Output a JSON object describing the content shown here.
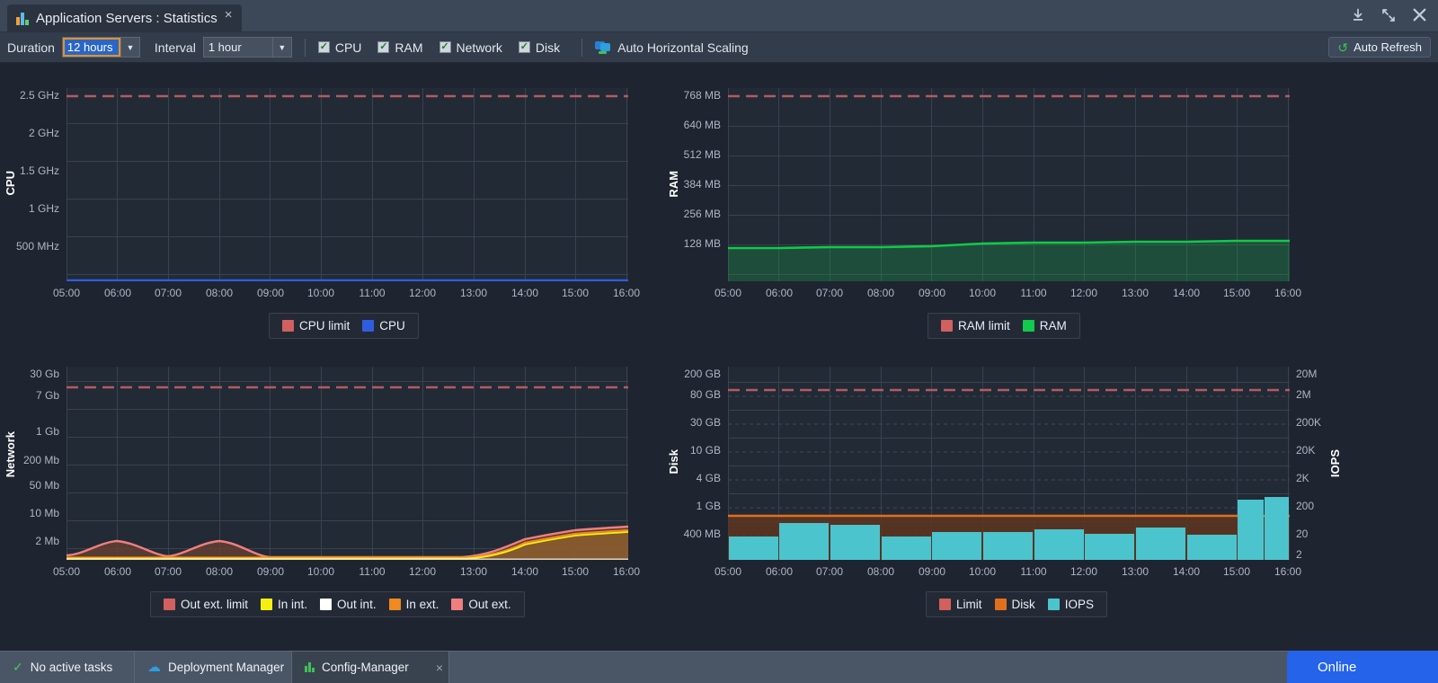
{
  "window": {
    "tab_title": "Application Servers : Statistics",
    "tab_close": "×",
    "download_icon": "download-icon",
    "restore_icon": "restore-icon",
    "close_icon": "✕"
  },
  "toolbar": {
    "duration_label": "Duration",
    "duration_value": "12 hours",
    "interval_label": "Interval",
    "interval_value": "1 hour",
    "arrow": "▼",
    "checkboxes": [
      {
        "label": "CPU",
        "checked": true,
        "mark": "✓"
      },
      {
        "label": "RAM",
        "checked": true,
        "mark": "✓"
      },
      {
        "label": "Network",
        "checked": true,
        "mark": "✓"
      },
      {
        "label": "Disk",
        "checked": true,
        "mark": "✓"
      }
    ],
    "auto_scaling_label": "Auto Horizontal Scaling",
    "auto_refresh_label": "Auto Refresh",
    "auto_refresh_icon": "↺"
  },
  "chart_data": [
    {
      "id": "cpu",
      "type": "area",
      "title": "",
      "ylabel": "CPU",
      "xlabel": "",
      "grid": true,
      "x": [
        "05:00",
        "06:00",
        "07:00",
        "08:00",
        "09:00",
        "10:00",
        "11:00",
        "12:00",
        "13:00",
        "14:00",
        "15:00",
        "16:00"
      ],
      "yticks": [
        "500 MHz",
        "1 GHz",
        "1.5 GHz",
        "2 GHz",
        "2.5 GHz"
      ],
      "ylim": [
        0,
        2.75
      ],
      "series": [
        {
          "name": "CPU limit",
          "color": "#d1605e",
          "style": "dashed",
          "value": 2.5,
          "values": [
            2.5,
            2.5,
            2.5,
            2.5,
            2.5,
            2.5,
            2.5,
            2.5,
            2.5,
            2.5,
            2.5,
            2.5
          ]
        },
        {
          "name": "CPU",
          "color": "#2f5de0",
          "style": "area",
          "values": [
            0.01,
            0.01,
            0.01,
            0.01,
            0.01,
            0.01,
            0.01,
            0.01,
            0.01,
            0.01,
            0.01,
            0.01
          ]
        }
      ],
      "legend": [
        {
          "label": "CPU limit",
          "color": "#d1605e"
        },
        {
          "label": "CPU",
          "color": "#2f5de0"
        }
      ]
    },
    {
      "id": "ram",
      "type": "area",
      "title": "",
      "ylabel": "RAM",
      "xlabel": "",
      "grid": true,
      "x": [
        "05:00",
        "06:00",
        "07:00",
        "08:00",
        "09:00",
        "10:00",
        "11:00",
        "12:00",
        "13:00",
        "14:00",
        "15:00",
        "16:00"
      ],
      "yticks": [
        "128 MB",
        "256 MB",
        "384 MB",
        "512 MB",
        "640 MB",
        "768 MB"
      ],
      "ylim": [
        0,
        845
      ],
      "series": [
        {
          "name": "RAM limit",
          "color": "#d1605e",
          "style": "dashed",
          "value": 768,
          "values": [
            768,
            768,
            768,
            768,
            768,
            768,
            768,
            768,
            768,
            768,
            768,
            768
          ]
        },
        {
          "name": "RAM",
          "color": "#11c94a",
          "style": "area",
          "values": [
            128,
            128,
            129,
            129,
            130,
            134,
            135,
            135,
            136,
            137,
            138,
            139
          ]
        }
      ],
      "legend": [
        {
          "label": "RAM limit",
          "color": "#d1605e"
        },
        {
          "label": "RAM",
          "color": "#11c94a"
        }
      ]
    },
    {
      "id": "network",
      "type": "area",
      "title": "",
      "ylabel": "Network",
      "xlabel": "",
      "grid": true,
      "scale": "log",
      "x": [
        "05:00",
        "06:00",
        "07:00",
        "08:00",
        "09:00",
        "10:00",
        "11:00",
        "12:00",
        "13:00",
        "14:00",
        "15:00",
        "16:00"
      ],
      "yticks": [
        "2 Mb",
        "10 Mb",
        "50 Mb",
        "200 Mb",
        "1 Gb",
        "7 Gb",
        "30 Gb"
      ],
      "series": [
        {
          "name": "Out ext. limit",
          "color": "#d1605e",
          "style": "dashed",
          "value": "30 Gb"
        },
        {
          "name": "In int.",
          "color": "#f5f012",
          "style": "area",
          "values": [
            0,
            0,
            0,
            0,
            0,
            0,
            0,
            0,
            0,
            0.1,
            1.2,
            1.5
          ]
        },
        {
          "name": "Out int.",
          "color": "#ffffff",
          "style": "area",
          "values": [
            0,
            0,
            0,
            0,
            0,
            0,
            0,
            0,
            0,
            0,
            0,
            0
          ]
        },
        {
          "name": "In ext.",
          "color": "#f0891e",
          "style": "area",
          "values": [
            0,
            0,
            0,
            0,
            0,
            0,
            0,
            0,
            0,
            0.1,
            1.3,
            1.6
          ]
        },
        {
          "name": "Out ext.",
          "color": "#ef7f7f",
          "style": "area",
          "values": [
            0.05,
            1.4,
            0.05,
            1.4,
            0.05,
            0,
            0,
            0,
            0,
            0.15,
            1.7,
            1.9
          ]
        }
      ],
      "legend": [
        {
          "label": "Out ext. limit",
          "color": "#d1605e"
        },
        {
          "label": "In int.",
          "color": "#f5f012"
        },
        {
          "label": "Out int.",
          "color": "#ffffff"
        },
        {
          "label": "In ext.",
          "color": "#f0891e"
        },
        {
          "label": "Out ext.",
          "color": "#ef7f7f"
        }
      ]
    },
    {
      "id": "disk",
      "type": "bar",
      "title": "",
      "ylabel": "Disk",
      "y2label": "IOPS",
      "xlabel": "",
      "grid": true,
      "scale": "log",
      "x": [
        "05:00",
        "06:00",
        "07:00",
        "08:00",
        "09:00",
        "10:00",
        "11:00",
        "12:00",
        "13:00",
        "14:00",
        "15:00",
        "16:00"
      ],
      "yticks": [
        "400 MB",
        "1 GB",
        "4 GB",
        "10 GB",
        "30 GB",
        "80 GB",
        "200 GB"
      ],
      "y2ticks": [
        "2",
        "20",
        "200",
        "2K",
        "20K",
        "200K",
        "2M",
        "20M"
      ],
      "series": [
        {
          "name": "Limit",
          "color": "#d1605e",
          "style": "dashed",
          "value": "80 GB"
        },
        {
          "name": "Disk",
          "color": "#e0701c",
          "style": "area",
          "value": "1 GB",
          "values": [
            1.15,
            1.15,
            1.15,
            1.15,
            1.15,
            1.15,
            1.15,
            1.15,
            1.15,
            1.15,
            1.15,
            1.15
          ]
        },
        {
          "name": "IOPS",
          "color": "#4cc4cd",
          "style": "bars",
          "values": [
            5,
            12,
            11,
            5,
            7,
            7,
            8,
            6,
            9,
            6,
            45,
            52
          ]
        }
      ],
      "legend": [
        {
          "label": "Limit",
          "color": "#d1605e"
        },
        {
          "label": "Disk",
          "color": "#e0701c"
        },
        {
          "label": "IOPS",
          "color": "#4cc4cd"
        }
      ]
    }
  ],
  "taskbar": {
    "no_active_tasks": "No active tasks",
    "deployment_manager": "Deployment Manager",
    "config_manager": "Config-Manager",
    "config_manager_close": "×",
    "status": "Online"
  }
}
